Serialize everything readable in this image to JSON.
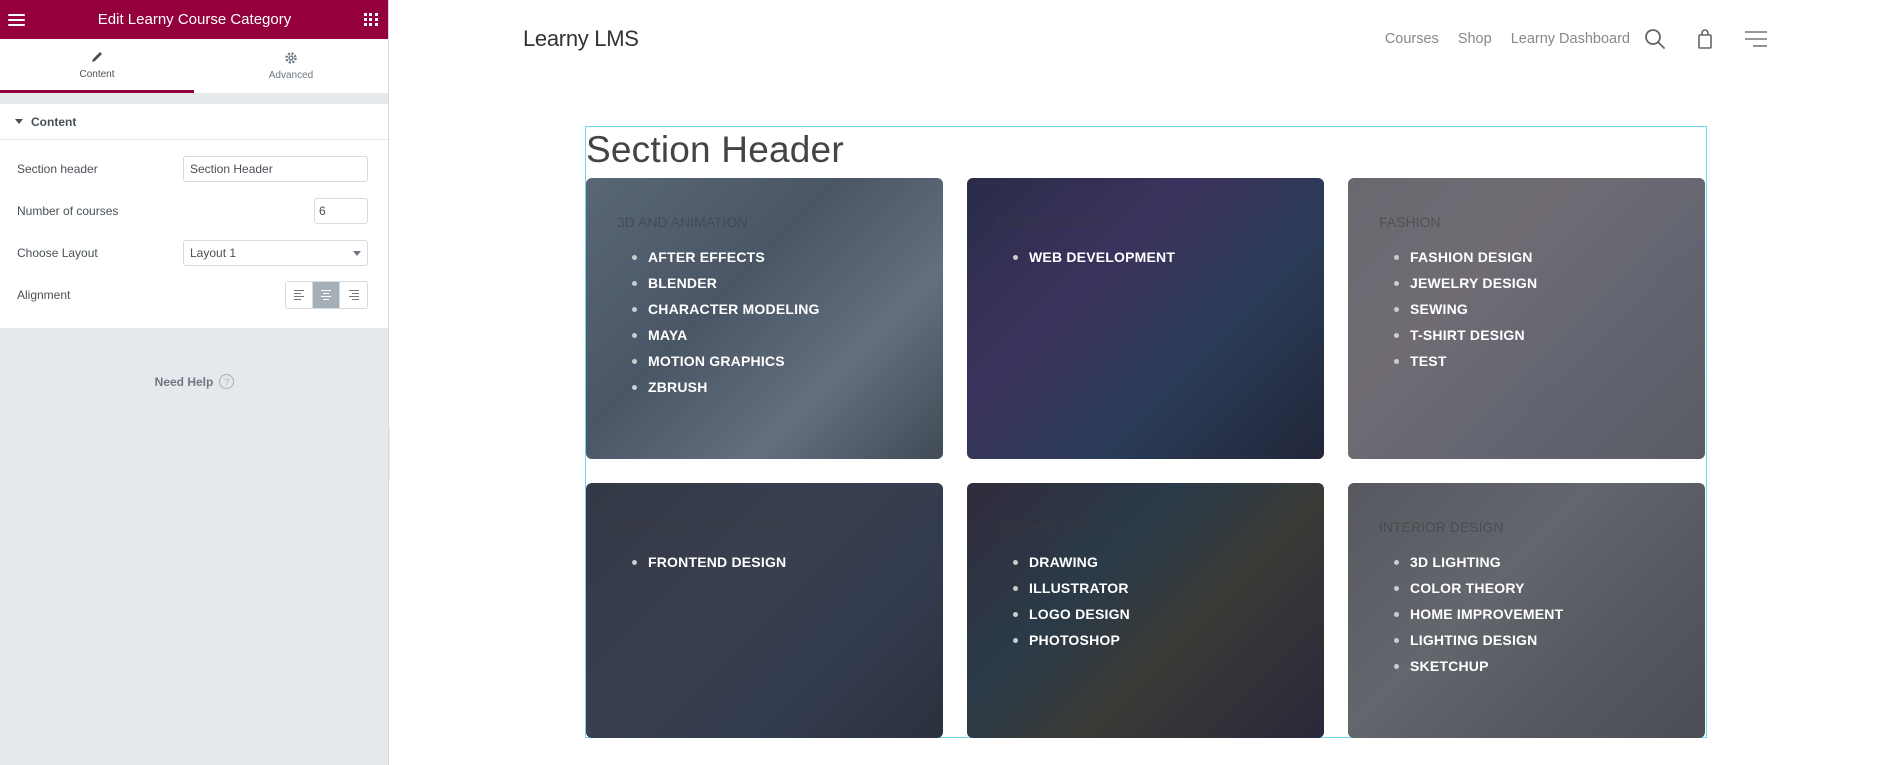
{
  "editor": {
    "title": "Edit Learny Course Category",
    "tabs": [
      {
        "label": "Content"
      },
      {
        "label": "Advanced"
      }
    ],
    "section_label": "Content",
    "controls": {
      "section_header": {
        "label": "Section header",
        "value": "Section Header"
      },
      "number_of_courses": {
        "label": "Number of courses",
        "value": "6"
      },
      "choose_layout": {
        "label": "Choose Layout",
        "value": "Layout 1"
      },
      "alignment": {
        "label": "Alignment",
        "selected": "center"
      }
    },
    "help_label": "Need Help",
    "accent_color": "#93003c"
  },
  "site": {
    "logo": "Learny LMS",
    "nav": [
      "Courses",
      "Shop",
      "Learny Dashboard"
    ],
    "icons": [
      "search-icon",
      "shopping-bag-icon",
      "menu-icon"
    ],
    "section_header": "Section Header",
    "categories": [
      {
        "title": "3D and Animation",
        "items": [
          "AFTER EFFECTS",
          "BLENDER",
          "CHARACTER MODELING",
          "MAYA",
          "MOTION GRAPHICS",
          "ZBRUSH"
        ]
      },
      {
        "title": "Development",
        "items": [
          "WEB DEVELOPMENT"
        ]
      },
      {
        "title": "Fashion",
        "items": [
          "FASHION DESIGN",
          "JEWELRY DESIGN",
          "SEWING",
          "T-SHIRT DESIGN",
          "TEST"
        ]
      },
      {
        "title": "Frontend Development",
        "items": [
          "FRONTEND DESIGN"
        ]
      },
      {
        "title": "Graphic Design",
        "items": [
          "DRAWING",
          "ILLUSTRATOR",
          "LOGO DESIGN",
          "PHOTOSHOP"
        ]
      },
      {
        "title": "Interior Design",
        "items": [
          "3D LIGHTING",
          "COLOR THEORY",
          "HOME IMPROVEMENT",
          "LIGHTING DESIGN",
          "SKETCHUP"
        ]
      }
    ]
  }
}
